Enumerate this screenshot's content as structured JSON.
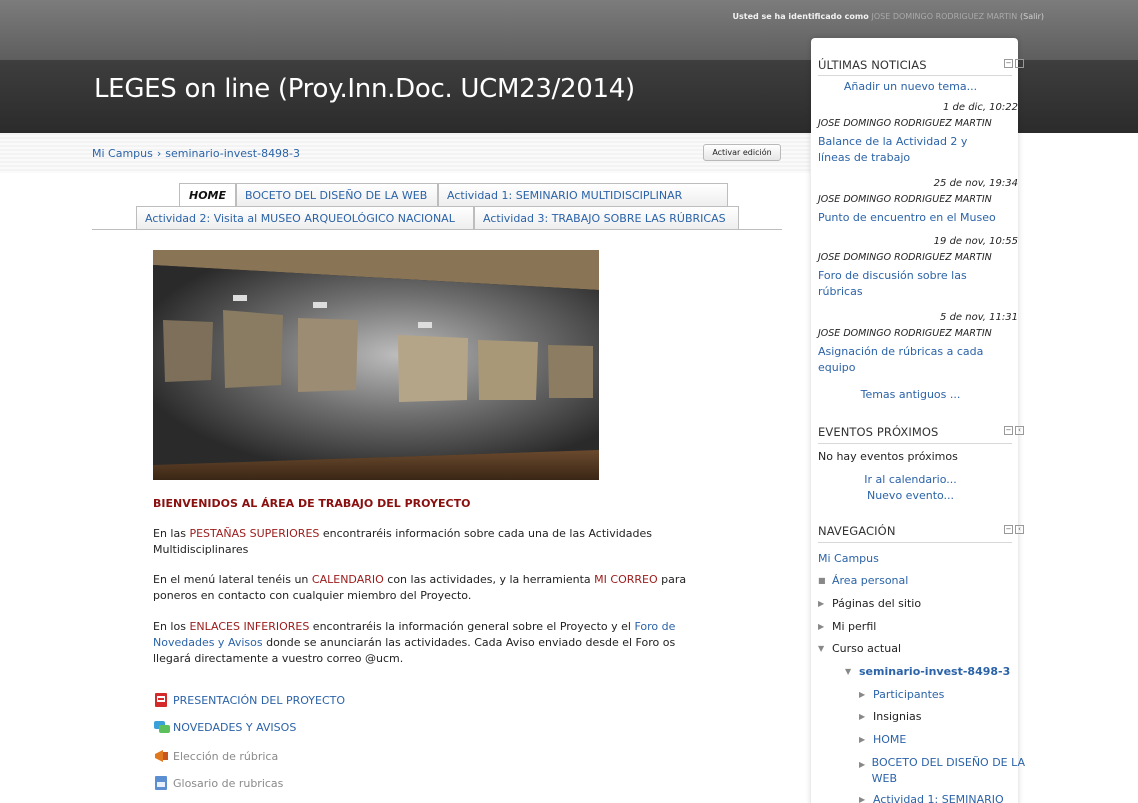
{
  "header": {
    "login_prefix": "Usted se ha identificado como",
    "user": "JOSE DOMINGO RODRIGUEZ MARTIN",
    "logout": "(Salir)",
    "site_title": "LEGES on line (Proy.Inn.Doc. UCM23/2014)"
  },
  "breadcrumb": {
    "home": "Mi Campus",
    "separator": "›",
    "course": "seminario-invest-8498-3"
  },
  "edit_button": "Activar edición",
  "tabs": {
    "row1": [
      "HOME",
      "BOCETO DEL DISEÑO DE LA WEB",
      "Actividad 1: SEMINARIO MULTIDISCIPLINAR"
    ],
    "row2": [
      "Actividad 2: Visita al MUSEO ARQUEOLÓGICO NACIONAL",
      "Actividad 3: TRABAJO SOBRE LAS RÚBRICAS"
    ]
  },
  "main": {
    "welcome_title": "BIENVENIDOS AL ÁREA DE TRABAJO DEL PROYECTO",
    "p1_a": "En las ",
    "p1_hl": "PESTAÑAS SUPERIORES",
    "p1_b": " encontraréis información sobre cada una de las Actividades Multidisciplinares",
    "p2_a": "En el menú lateral tenéis un ",
    "p2_hl1": "CALENDARIO",
    "p2_b": " con las actividades, y la herramienta ",
    "p2_hl2": "MI CORREO",
    "p2_c": " para poneros en contacto con cualquier miembro del Proyecto.",
    "p3_a": "En los ",
    "p3_hl": "ENLACES INFERIORES",
    "p3_b": " encontraréis la información general sobre el Proyecto y el ",
    "p3_link": "Foro de Novedades y Avisos",
    "p3_c": " donde se anunciarán las actividades. Cada Aviso enviado desde el Foro os llegará directamente a vuestro correo @ucm.",
    "resources": [
      {
        "label": "PRESENTACIÓN DEL PROYECTO",
        "icon": "pdf-icon"
      },
      {
        "label": "NOVEDADES Y AVISOS",
        "icon": "forum-icon"
      },
      {
        "label": "Elección de rúbrica",
        "icon": "megaphone-icon"
      },
      {
        "label": "Glosario de rubricas",
        "icon": "glossary-icon"
      }
    ]
  },
  "news": {
    "title": "ÚLTIMAS NOTICIAS",
    "add_topic": "Añadir un nuevo tema...",
    "items": [
      {
        "date": "1 de dic, 10:22",
        "author": "JOSE DOMINGO RODRIGUEZ MARTIN",
        "subject": "Balance de la Actividad 2 y líneas de trabajo"
      },
      {
        "date": "25 de nov, 19:34",
        "author": "JOSE DOMINGO RODRIGUEZ MARTIN",
        "subject": "Punto de encuentro en el Museo"
      },
      {
        "date": "19 de nov, 10:55",
        "author": "JOSE DOMINGO RODRIGUEZ MARTIN",
        "subject": "Foro de discusión sobre las rúbricas"
      },
      {
        "date": "5 de nov, 11:31",
        "author": "JOSE DOMINGO RODRIGUEZ MARTIN",
        "subject": "Asignación de rúbricas a cada equipo"
      }
    ],
    "older": "Temas antiguos ..."
  },
  "events": {
    "title": "EVENTOS PRÓXIMOS",
    "none": "No hay eventos próximos",
    "calendar": "Ir al calendario...",
    "new_event": "Nuevo evento..."
  },
  "navigation": {
    "title": "NAVEGACIÓN",
    "home": "Mi Campus",
    "items": [
      "Área personal",
      "Páginas del sitio",
      "Mi perfil",
      "Curso actual",
      "seminario-invest-8498-3",
      "Participantes",
      "Insignias",
      "HOME",
      "BOCETO DEL DISEÑO DE LA WEB",
      "Actividad 1: SEMINARIO"
    ]
  },
  "colors": {
    "link": "#2b63a8",
    "highlight": "#9b1a1a",
    "header_dark": "#2b2b2b"
  }
}
